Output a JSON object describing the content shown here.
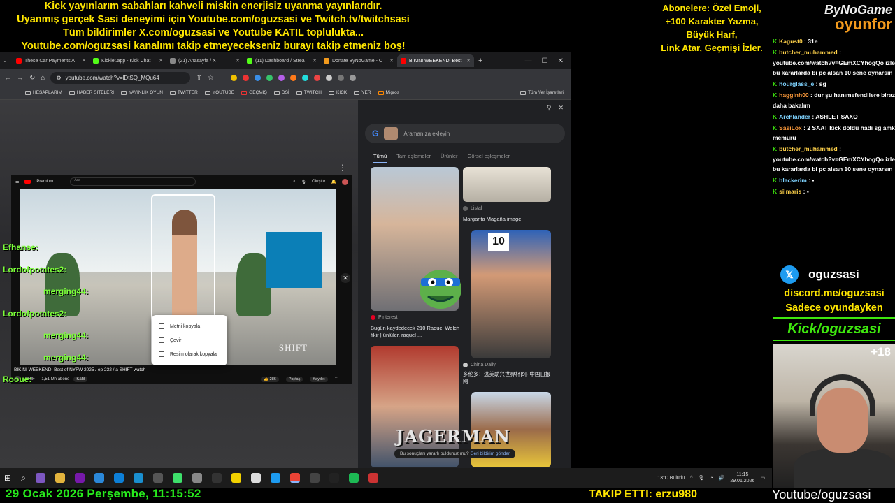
{
  "overlay": {
    "top_lines": [
      "Kick yayınlarım sabahları kahveli miskin enerjisiz uyanma yayınlarıdır.",
      "Uyanmış gerçek Sasi deneyimi için Youtube.com/oguzsasi ve Twitch.tv/twitchsasi",
      "Tüm bildirimler X.com/oguzsasi ve Youtube KATIL toplulukta...",
      "Youtube.com/oguzsasi kanalımı takip etmeyecekseniz burayı takip etmeniz boş!"
    ],
    "sub_lines": [
      "Abonelere: Özel Emoji,",
      "+100 Karakter Yazma,",
      "Büyük Harf,",
      "Link Atar, Geçmişi İzler."
    ],
    "logo_top": "ByNoGame",
    "logo_bottom": "oyunfor",
    "date_time": "29 Ocak 2026 Perşembe, 11:15:52",
    "followed": "TAKIP ETTI: erzu980",
    "youtube_handle": "Youtube/oguzsasi",
    "age_badge": "+18"
  },
  "browser": {
    "tabs": [
      {
        "label": "These Car Payments A",
        "color": "#ff0000",
        "active": false
      },
      {
        "label": "Kicklet.app - Kick Chat",
        "color": "#53fc18",
        "active": false
      },
      {
        "label": "(21) Anasayfa / X",
        "color": "#000000",
        "active": false
      },
      {
        "label": "(11) Dashboard / Strea",
        "color": "#53fc18",
        "active": false
      },
      {
        "label": "Donate ByNoGame - C",
        "color": "#f29a1d",
        "active": false
      },
      {
        "label": "BIKINI WEEKEND: Best",
        "color": "#ff0000",
        "active": true
      }
    ],
    "url": "youtube.com/watch?v=lDtSQ_MQu64",
    "bookmarks": [
      "HESAPLARIM",
      "HABER SITELERI",
      "YAYINLIK OYUN",
      "TWITTER",
      "YOUTUBE",
      "GEÇMIŞ",
      "DSİ",
      "TWITCH",
      "KICK",
      "YER",
      "Migros"
    ],
    "all_bookmarks": "Tüm Yer İşaretleri"
  },
  "youtube": {
    "brand": "Premium",
    "search_placeholder": "Ara",
    "create_label": "Oluştur",
    "video_title": "BIKINI WEEKEND: Best of NYFW 2025 / ep 232 / a SHIFT watch",
    "channel": "SHIFT",
    "subscribers": "1,51 Mn abone",
    "join": "Katıl",
    "likes": "286",
    "share": "Paylaş",
    "save": "Kaydet",
    "watermark": "SHIFT"
  },
  "overlay_chat": [
    "Efhanse:",
    "Lordofpotates2:",
    "merging44:",
    "Lordofpotates2:",
    "merging44:",
    "merging44:",
    "Rooue:"
  ],
  "context_menu": [
    "Metni kopyala",
    "Çevir",
    "Resim olarak kopyala"
  ],
  "lens": {
    "search_placeholder": "Aramanıza ekleyin",
    "tabs": [
      "Tümü",
      "Tam eşlemeler",
      "Ürünler",
      "Görsel eşleşmeler"
    ],
    "results": [
      {
        "source": "Listal",
        "title": "Margarita Magaña image"
      },
      {
        "source": "Pinterest",
        "title": "Bugün kaydedecek 210 Raquel Welch fikir | ünlüler, raquel ..."
      },
      {
        "source": "China Daily",
        "title": "多伦多：逃美助兴世界杯[9]- 中国日报网"
      }
    ],
    "sign_number": "10",
    "feedback_q": "Bu sonuçları yararlı buldunuz mu?",
    "feedback_link": "Geri bildirim gönder",
    "sponsor": "JAGERMAN"
  },
  "taskbar": {
    "weather": "13°C  Bulutlu",
    "time": "11:15",
    "date": "29.01.2026"
  },
  "chat": [
    {
      "user": "Kagust0",
      "text": "31e",
      "cls": ""
    },
    {
      "user": "butcher_muhammed",
      "text": "youtube.com/watch?v=GEmXCYhogQo izle bu kararlarda bi pc alsan 10 sene oynarsın",
      "cls": ""
    },
    {
      "user": "hourglass_e",
      "text": "sg",
      "cls": "blue"
    },
    {
      "user": "hagginh00",
      "text": "dur şu hanımefendilere biraz daha bakalım",
      "cls": "orange"
    },
    {
      "user": "Archlander",
      "text": "ASHLET SAXO",
      "cls": "blue"
    },
    {
      "user": "SasiLox",
      "text": "2 SAAT kick doldu hadi sg amk memuru",
      "cls": "orange"
    },
    {
      "user": "butcher_muhammed",
      "text": "youtube.com/watch?v=GEmXCYhogQo izle bu kararlarda bi pc alsan 10 sene oynarsın",
      "cls": ""
    },
    {
      "user": "blackerim",
      "text": "",
      "cls": "blue"
    },
    {
      "user": "silmaris",
      "text": "",
      "cls": ""
    }
  ],
  "social": {
    "x_handle": "oguzsasi",
    "discord": "discord.me/oguzsasi",
    "note": "Sadece oyundayken",
    "kick": "Kick/oguzsasi"
  },
  "icons": [
    "google-icon",
    "pin-icon",
    "close-icon",
    "search-icon",
    "mic-icon",
    "bell-icon",
    "windows-start-icon",
    "wifi-icon",
    "volume-icon"
  ]
}
